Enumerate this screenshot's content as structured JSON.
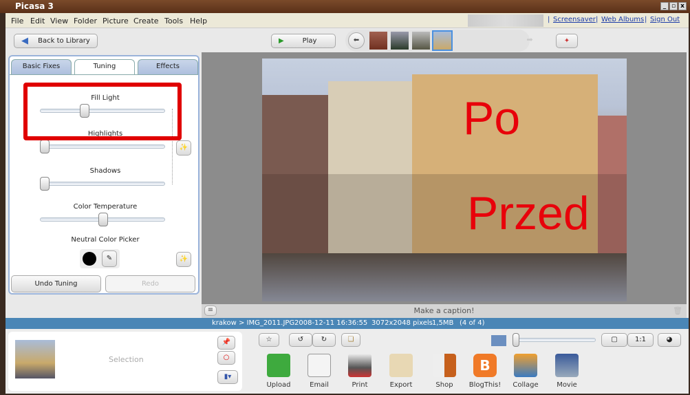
{
  "window": {
    "title": "Picasa 3",
    "min": "_",
    "max": "▫",
    "close": "x"
  },
  "menu": [
    "File",
    "Edit",
    "View",
    "Folder",
    "Picture",
    "Create",
    "Tools",
    "Help"
  ],
  "links": [
    "Screensaver",
    "Web Albums",
    "Sign Out"
  ],
  "toolbar": {
    "back": "Back to Library",
    "play": "Play"
  },
  "tabs": [
    "Basic Fixes",
    "Tuning",
    "Effects"
  ],
  "sliders": [
    {
      "label": "Fill Light",
      "value": 0.35
    },
    {
      "label": "Highlights",
      "value": 0
    },
    {
      "label": "Shadows",
      "value": 0
    },
    {
      "label": "Color Temperature",
      "value": 0.5
    }
  ],
  "neutral_picker": "Neutral Color Picker",
  "undo": "Undo Tuning",
  "redo": "Redo",
  "photo_overlay": {
    "top": "Po",
    "bottom": "Przed"
  },
  "caption": "Make a caption!",
  "status": {
    "path": "krakow > IMG_2011.JPG",
    "date": "2008-12-11 16:36:55",
    "dims": "3072x2048 pixels",
    "size": "1,5MB",
    "count": "(4 of 4)"
  },
  "selection": "Selection",
  "zoom": {
    "one_to_one": "1:1",
    "value": 0
  },
  "actions": [
    "Upload",
    "Email",
    "Print",
    "Export",
    "Shop",
    "BlogThis!",
    "Collage",
    "Movie"
  ]
}
